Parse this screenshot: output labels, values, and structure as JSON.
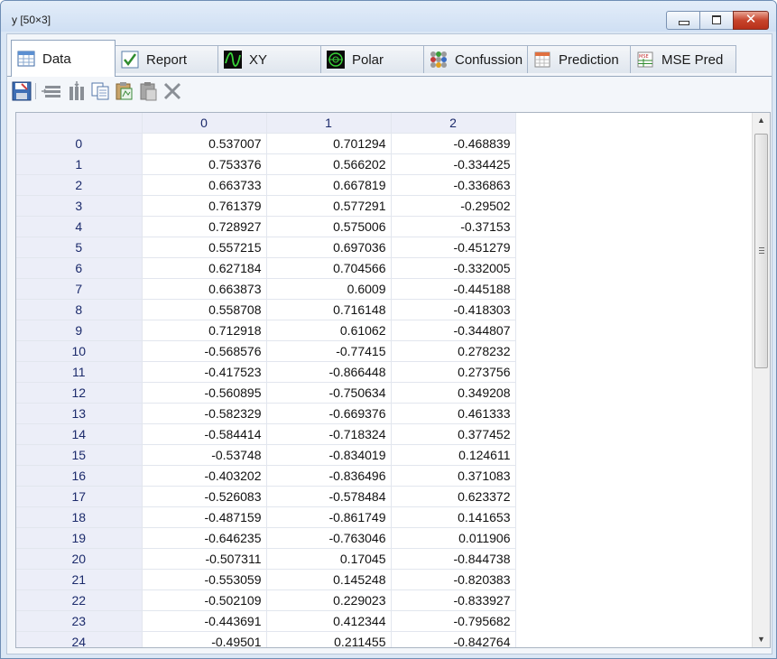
{
  "window": {
    "title": "y [50×3]"
  },
  "tabs": [
    {
      "label": "Data",
      "icon": "data-grid-icon"
    },
    {
      "label": "Report",
      "icon": "checkmark-icon"
    },
    {
      "label": "XY",
      "icon": "xy-plot-icon"
    },
    {
      "label": "Polar",
      "icon": "polar-plot-icon"
    },
    {
      "label": "Confussion",
      "icon": "confusion-matrix-icon"
    },
    {
      "label": "Prediction",
      "icon": "prediction-table-icon"
    },
    {
      "label": "MSE Pred",
      "icon": "mse-pred-icon"
    }
  ],
  "toolbar": [
    "save-icon",
    "insert-row-icon",
    "insert-column-icon",
    "copy-icon",
    "paste-special-icon",
    "paste-icon",
    "delete-icon"
  ],
  "table": {
    "columns": [
      "0",
      "1",
      "2"
    ],
    "rows": [
      {
        "index": "0",
        "values": [
          "0.537007",
          "0.701294",
          "-0.468839"
        ]
      },
      {
        "index": "1",
        "values": [
          "0.753376",
          "0.566202",
          "-0.334425"
        ]
      },
      {
        "index": "2",
        "values": [
          "0.663733",
          "0.667819",
          "-0.336863"
        ]
      },
      {
        "index": "3",
        "values": [
          "0.761379",
          "0.577291",
          "-0.29502"
        ]
      },
      {
        "index": "4",
        "values": [
          "0.728927",
          "0.575006",
          "-0.37153"
        ]
      },
      {
        "index": "5",
        "values": [
          "0.557215",
          "0.697036",
          "-0.451279"
        ]
      },
      {
        "index": "6",
        "values": [
          "0.627184",
          "0.704566",
          "-0.332005"
        ]
      },
      {
        "index": "7",
        "values": [
          "0.663873",
          "0.6009",
          "-0.445188"
        ]
      },
      {
        "index": "8",
        "values": [
          "0.558708",
          "0.716148",
          "-0.418303"
        ]
      },
      {
        "index": "9",
        "values": [
          "0.712918",
          "0.61062",
          "-0.344807"
        ]
      },
      {
        "index": "10",
        "values": [
          "-0.568576",
          "-0.77415",
          "0.278232"
        ]
      },
      {
        "index": "11",
        "values": [
          "-0.417523",
          "-0.866448",
          "0.273756"
        ]
      },
      {
        "index": "12",
        "values": [
          "-0.560895",
          "-0.750634",
          "0.349208"
        ]
      },
      {
        "index": "13",
        "values": [
          "-0.582329",
          "-0.669376",
          "0.461333"
        ]
      },
      {
        "index": "14",
        "values": [
          "-0.584414",
          "-0.718324",
          "0.377452"
        ]
      },
      {
        "index": "15",
        "values": [
          "-0.53748",
          "-0.834019",
          "0.124611"
        ]
      },
      {
        "index": "16",
        "values": [
          "-0.403202",
          "-0.836496",
          "0.371083"
        ]
      },
      {
        "index": "17",
        "values": [
          "-0.526083",
          "-0.578484",
          "0.623372"
        ]
      },
      {
        "index": "18",
        "values": [
          "-0.487159",
          "-0.861749",
          "0.141653"
        ]
      },
      {
        "index": "19",
        "values": [
          "-0.646235",
          "-0.763046",
          "0.011906"
        ]
      },
      {
        "index": "20",
        "values": [
          "-0.507311",
          "0.17045",
          "-0.844738"
        ]
      },
      {
        "index": "21",
        "values": [
          "-0.553059",
          "0.145248",
          "-0.820383"
        ]
      },
      {
        "index": "22",
        "values": [
          "-0.502109",
          "0.229023",
          "-0.833927"
        ]
      },
      {
        "index": "23",
        "values": [
          "-0.443691",
          "0.412344",
          "-0.795682"
        ]
      },
      {
        "index": "24",
        "values": [
          "-0.49501",
          "0.211455",
          "-0.842764"
        ]
      }
    ]
  }
}
